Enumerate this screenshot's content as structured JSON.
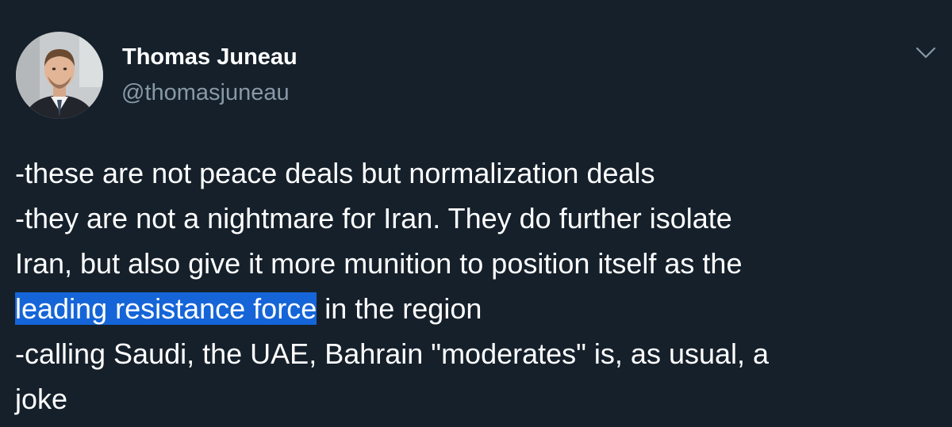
{
  "author": {
    "display_name": "Thomas Juneau",
    "handle": "@thomasjuneau",
    "avatar_icon": "profile-photo"
  },
  "menu": {
    "caret_icon": "chevron-down-icon"
  },
  "tweet": {
    "lines": {
      "l1": "-these are not peace deals but normalization deals",
      "l2": "-they are not a nightmare for Iran. They do further isolate",
      "l3": "Iran, but also give it more munition to position itself as the",
      "l4_highlighted": "leading resistance force",
      "l4_rest": " in the region",
      "l5": "-calling Saudi, the UAE, Bahrain \"moderates\" is, as usual, a",
      "l6": "joke"
    }
  },
  "colors": {
    "background": "#15202b",
    "text": "#ffffff",
    "secondary_text": "#8899a6",
    "selection": "#1565d8"
  }
}
